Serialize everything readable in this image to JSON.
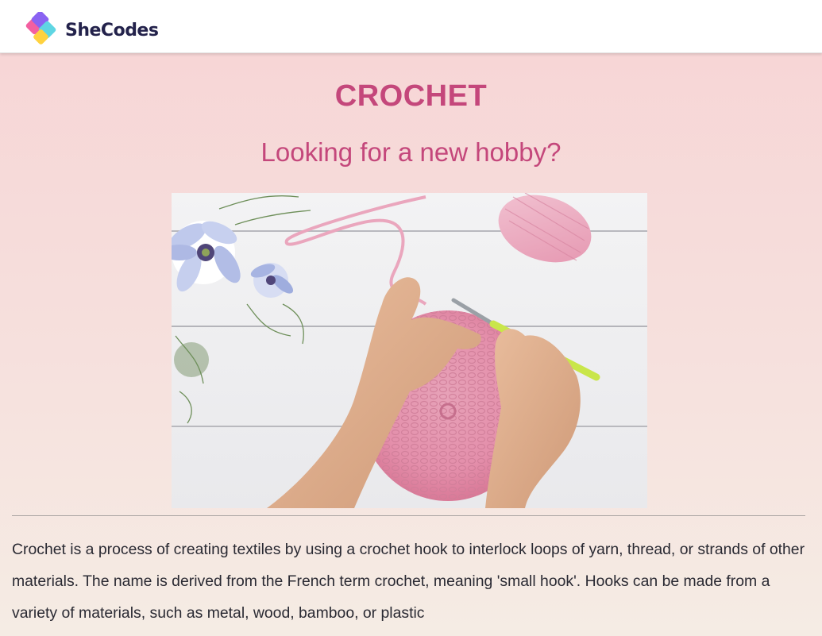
{
  "header": {
    "brand_name": "SheCodes",
    "logo_icon": "shecodes-diamond-logo",
    "colors": {
      "background": "#ffffff",
      "brand_text": "#23224b"
    }
  },
  "main": {
    "title": "CROCHET",
    "subtitle": "Looking for a new hobby?",
    "hero_image": {
      "content": "hands crocheting pink yarn circle with green hook, white wood table, blue flowers",
      "alt": "Hands crocheting a pink circle"
    },
    "description": "Crochet is a process of creating textiles by using a crochet hook to interlock loops of yarn, thread, or strands of other materials. The name is derived from the French term crochet, meaning 'small hook'. Hooks can be made from a variety of materials, such as metal, wood, bamboo, or plastic",
    "colors": {
      "heading": "#c4477b",
      "background_top": "#f7d4d5",
      "background_bottom": "#f5ece4",
      "body_text": "#2a2a33"
    }
  }
}
